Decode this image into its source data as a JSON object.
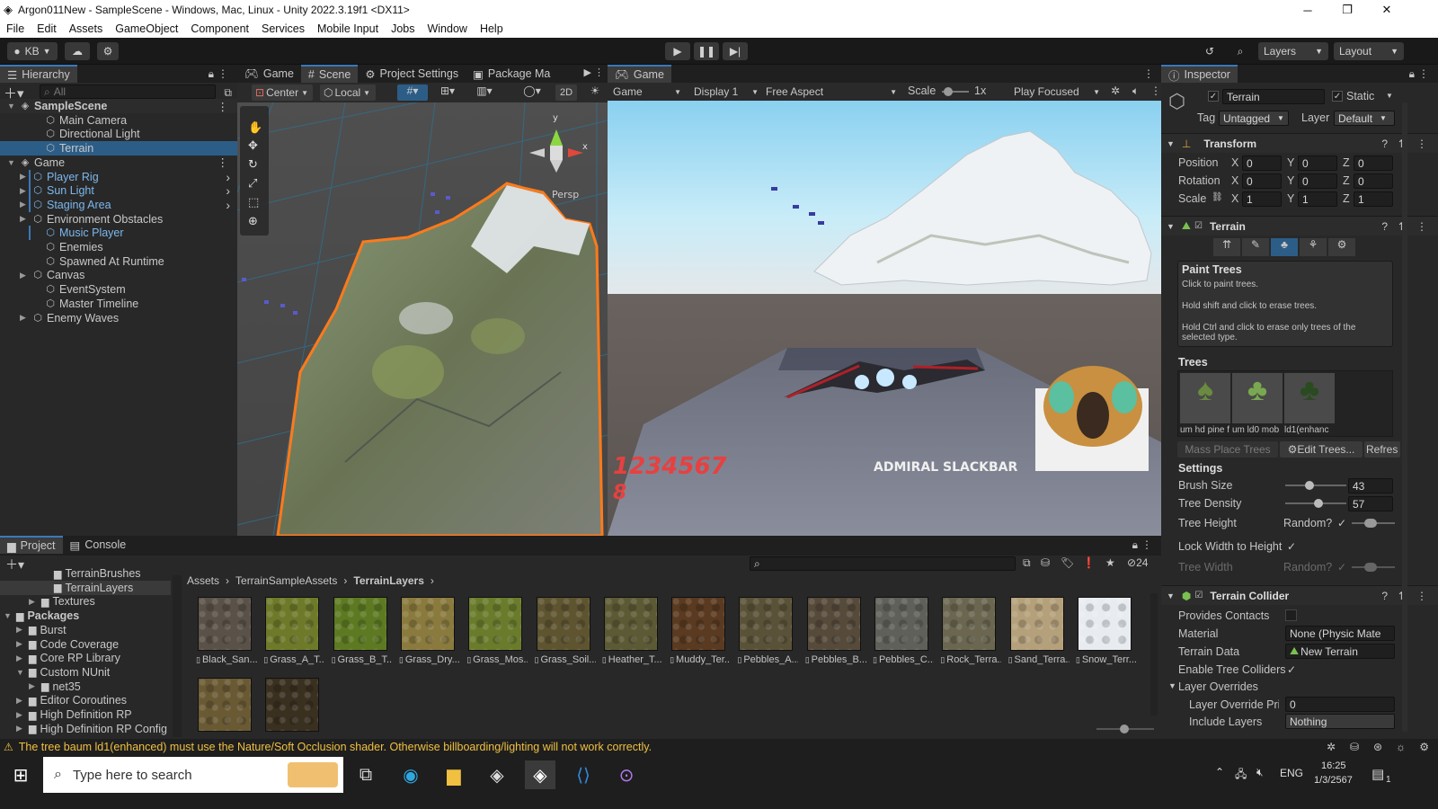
{
  "window": {
    "title": "Argon011New - SampleScene - Windows, Mac, Linux - Unity 2022.3.19f1 <DX11>"
  },
  "menu": [
    "File",
    "Edit",
    "Assets",
    "GameObject",
    "Component",
    "Services",
    "Mobile Input",
    "Jobs",
    "Window",
    "Help"
  ],
  "toolbar": {
    "account": "KB",
    "layers": "Layers",
    "layout": "Layout"
  },
  "hierarchy": {
    "tab": "Hierarchy",
    "search_placeholder": "All",
    "items": [
      {
        "label": "SampleScene",
        "indent": 0,
        "bold": true,
        "expanded": true,
        "type": "scene"
      },
      {
        "label": "Main Camera",
        "indent": 2,
        "type": "object"
      },
      {
        "label": "Directional Light",
        "indent": 2,
        "type": "object"
      },
      {
        "label": "Terrain",
        "indent": 2,
        "type": "object",
        "selected": true
      },
      {
        "label": "Game",
        "indent": 0,
        "expanded": true,
        "type": "scene"
      },
      {
        "label": "Player Rig",
        "indent": 1,
        "type": "prefab",
        "arrow": true
      },
      {
        "label": "Sun Light",
        "indent": 1,
        "type": "prefab",
        "arrow": true
      },
      {
        "label": "Staging Area",
        "indent": 1,
        "type": "prefab",
        "arrow": true
      },
      {
        "label": "Environment Obstacles",
        "indent": 1,
        "type": "object",
        "arrow": true
      },
      {
        "label": "Music Player",
        "indent": 2,
        "type": "prefab"
      },
      {
        "label": "Enemies",
        "indent": 2,
        "type": "object"
      },
      {
        "label": "Spawned At Runtime",
        "indent": 2,
        "type": "object"
      },
      {
        "label": "Canvas",
        "indent": 1,
        "type": "object",
        "arrow": true
      },
      {
        "label": "EventSystem",
        "indent": 2,
        "type": "object"
      },
      {
        "label": "Master Timeline",
        "indent": 2,
        "type": "object"
      },
      {
        "label": "Enemy Waves",
        "indent": 1,
        "type": "object",
        "arrow": true
      }
    ]
  },
  "scene": {
    "tabs": [
      "Game",
      "Scene",
      "Project Settings",
      "Package Ma"
    ],
    "pivot": "Center",
    "space": "Local",
    "mode2d": "2D",
    "persp": "Persp",
    "gizmo_y": "y",
    "gizmo_x": "x"
  },
  "game": {
    "tab": "Game",
    "view": "Game",
    "display": "Display 1",
    "aspect": "Free Aspect",
    "scale_label": "Scale",
    "scale_value": "1x",
    "play_mode": "Play Focused",
    "score": "1234567",
    "lives": "8",
    "npc_name": "ADMIRAL SLACKBAR"
  },
  "inspector": {
    "tab": "Inspector",
    "object_name": "Terrain",
    "static": "Static",
    "tag_label": "Tag",
    "tag": "Untagged",
    "layer_label": "Layer",
    "layer": "Default",
    "transform": {
      "title": "Transform",
      "rows": [
        {
          "label": "Position",
          "x": "0",
          "y": "0",
          "z": "0"
        },
        {
          "label": "Rotation",
          "x": "0",
          "y": "0",
          "z": "0"
        },
        {
          "label": "Scale",
          "x": "1",
          "y": "1",
          "z": "1"
        }
      ]
    },
    "terrain": {
      "title": "Terrain",
      "help_title": "Paint Trees",
      "help1": "Click to paint trees.",
      "help2": "Hold shift and click to erase trees.",
      "help3": "Hold Ctrl and click to erase only trees of the selected type.",
      "trees_title": "Trees",
      "tree_names": [
        "um hd pine f",
        "um ld0 mob",
        "ld1(enhanc"
      ],
      "mass_place": "Mass Place Trees",
      "edit_trees": "Edit Trees...",
      "refresh": "Refres",
      "settings_title": "Settings",
      "brush_size_label": "Brush Size",
      "brush_size": "43",
      "tree_density_label": "Tree Density",
      "tree_density": "57",
      "tree_height_label": "Tree Height",
      "random_label": "Random?",
      "lock_label": "Lock Width to Height",
      "tree_width_label": "Tree Width",
      "random_label2": "Random?"
    },
    "collider": {
      "title": "Terrain Collider",
      "provides_contacts": "Provides Contacts",
      "material_label": "Material",
      "material": "None (Physic Mate",
      "terrain_data_label": "Terrain Data",
      "terrain_data": "New Terrain",
      "enable_tree_label": "Enable Tree Colliders",
      "layer_overrides": "Layer Overrides",
      "layer_override_label": "Layer Override Pric",
      "layer_override": "0",
      "include_label": "Include Layers",
      "include": "Nothing"
    }
  },
  "project": {
    "tabs": [
      "Project",
      "Console"
    ],
    "breadcrumb": [
      "Assets",
      "TerrainSampleAssets",
      "TerrainLayers"
    ],
    "hidden_count": "24",
    "tree": [
      {
        "label": "TerrainBrushes",
        "indent": 3
      },
      {
        "label": "TerrainLayers",
        "indent": 3,
        "selected": true
      },
      {
        "label": "Textures",
        "indent": 2,
        "arrow": true
      },
      {
        "label": "Packages",
        "indent": 0,
        "bold": true,
        "arrow": true,
        "expanded": true
      },
      {
        "label": "Burst",
        "indent": 1,
        "arrow": true
      },
      {
        "label": "Code Coverage",
        "indent": 1,
        "arrow": true
      },
      {
        "label": "Core RP Library",
        "indent": 1,
        "arrow": true
      },
      {
        "label": "Custom NUnit",
        "indent": 1,
        "arrow": true,
        "expanded": true
      },
      {
        "label": "net35",
        "indent": 2,
        "arrow": true
      },
      {
        "label": "Editor Coroutines",
        "indent": 1,
        "arrow": true
      },
      {
        "label": "High Definition RP",
        "indent": 1,
        "arrow": true
      },
      {
        "label": "High Definition RP Config",
        "indent": 1,
        "arrow": true
      }
    ],
    "assets": [
      {
        "name": "Black_San...",
        "color": "#5a5248"
      },
      {
        "name": "Grass_A_T...",
        "color": "#6e7a2a"
      },
      {
        "name": "Grass_B_T...",
        "color": "#5d7a22"
      },
      {
        "name": "Grass_Dry...",
        "color": "#8a7a3e"
      },
      {
        "name": "Grass_Mos...",
        "color": "#6a7c2c"
      },
      {
        "name": "Grass_Soil...",
        "color": "#5e5430"
      },
      {
        "name": "Heather_T...",
        "color": "#5c5a34"
      },
      {
        "name": "Muddy_Ter...",
        "color": "#5a3a20"
      },
      {
        "name": "Pebbles_A...",
        "color": "#5a5238"
      },
      {
        "name": "Pebbles_B...",
        "color": "#564a3a"
      },
      {
        "name": "Pebbles_C...",
        "color": "#60605a"
      },
      {
        "name": "Rock_Terra...",
        "color": "#6a6650"
      },
      {
        "name": "Sand_Terra...",
        "color": "#b4a07a"
      },
      {
        "name": "Snow_Terr...",
        "color": "#e8ecf0"
      },
      {
        "name": "",
        "color": "#6a5a34"
      },
      {
        "name": "",
        "color": "#3a3020"
      }
    ]
  },
  "status": {
    "warning": "The tree baum ld1(enhanced) must use the Nature/Soft Occlusion shader. Otherwise billboarding/lighting will not work correctly."
  },
  "taskbar": {
    "search_placeholder": "Type here to search",
    "language": "ENG",
    "time": "16:25",
    "date": "1/3/2567",
    "notifications": "1"
  },
  "colors": {
    "accent": "#3a79bb",
    "selection": "#2c5d87",
    "prefab": "#7cb8ee",
    "warning": "#f0c040",
    "highlight": "#ff7a1a"
  }
}
